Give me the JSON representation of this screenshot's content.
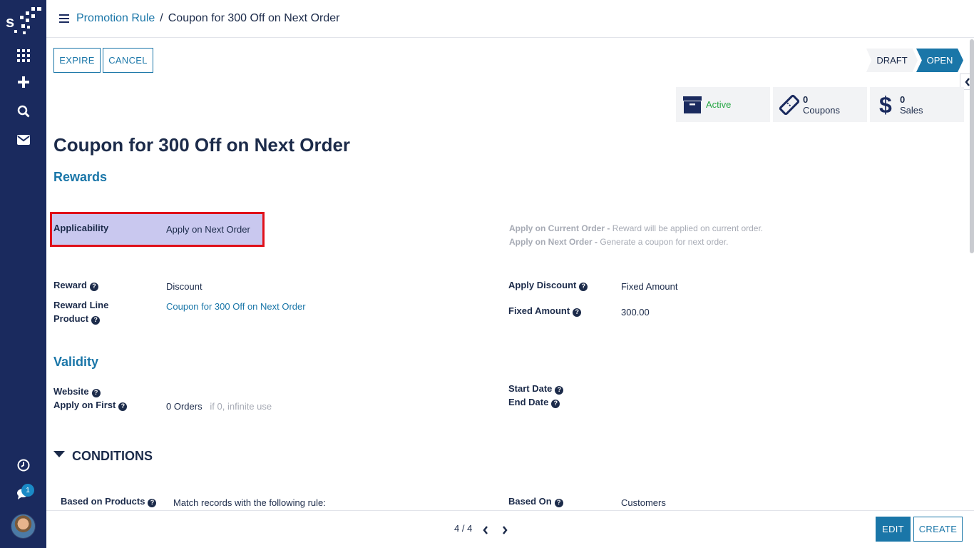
{
  "sidebar": {
    "logo_icon": "app-logo",
    "icons": [
      "apps-grid-icon",
      "plus-icon",
      "search-icon",
      "mail-icon",
      "clock-icon",
      "chat-icon"
    ],
    "chat_badge": "1"
  },
  "breadcrumb": {
    "parent": "Promotion Rule",
    "separator": "/",
    "current": "Coupon for 300 Off on Next Order"
  },
  "actions": {
    "expire": "EXPIRE",
    "cancel": "CANCEL"
  },
  "status": {
    "draft": "DRAFT",
    "open": "OPEN"
  },
  "smart_buttons": {
    "active": {
      "label": "Active",
      "icon": "archive-icon"
    },
    "coupons": {
      "count": "0",
      "label": "Coupons",
      "icon": "ticket-icon"
    },
    "sales": {
      "count": "0",
      "label": "Sales",
      "icon": "dollar-icon"
    }
  },
  "form": {
    "title": "Coupon for 300 Off on Next Order",
    "rewards_section": "Rewards",
    "applicability_label": "Applicability",
    "applicability_value": "Apply on Next Order",
    "hint_current_bold": "Apply on Current Order - ",
    "hint_current_text": "Reward will be applied on current order.",
    "hint_next_bold": "Apply on Next Order - ",
    "hint_next_text": "Generate a coupon for next order.",
    "reward_label": "Reward",
    "reward_value": "Discount",
    "reward_line_label_1": "Reward Line",
    "reward_line_label_2": "Product",
    "reward_line_value": "Coupon for 300 Off on Next Order",
    "apply_discount_label": "Apply Discount",
    "apply_discount_value": "Fixed Amount",
    "fixed_amount_label": "Fixed Amount",
    "fixed_amount_value": "300.00",
    "validity_section": "Validity",
    "website_label": "Website",
    "apply_first_label": "Apply on First",
    "apply_first_value": "0 Orders",
    "apply_first_hint": "if 0, infinite use",
    "start_date_label": "Start Date",
    "end_date_label": "End Date",
    "conditions_section": "CONDITIONS",
    "based_products_label": "Based on Products",
    "based_products_value": "Match records with the following rule:",
    "based_on_label": "Based On",
    "based_on_value": "Customers"
  },
  "footer": {
    "pager": "4 / 4",
    "edit": "EDIT",
    "create": "CREATE"
  },
  "colors": {
    "sidebar": "#1a2a5e",
    "accent": "#1a76a8",
    "active_green": "#28a745",
    "highlight_border": "#e0101a"
  }
}
